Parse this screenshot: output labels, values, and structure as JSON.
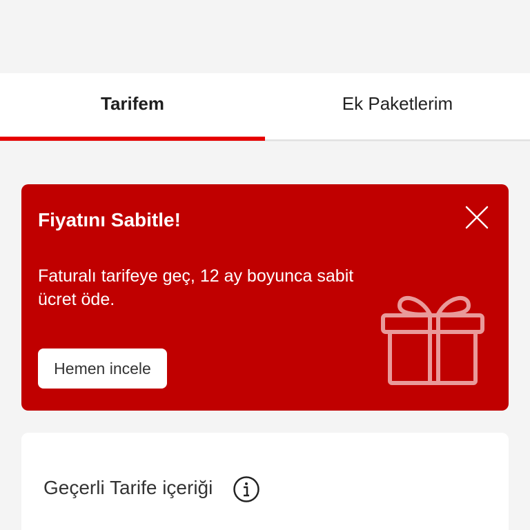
{
  "tabs": [
    {
      "label": "Tarifem",
      "active": true
    },
    {
      "label": "Ek Paketlerim",
      "active": false
    }
  ],
  "promo": {
    "title": "Fiyatını Sabitle!",
    "description": "Faturalı tarifeye geç, 12 ay boyunca sabit ücret öde.",
    "button_label": "Hemen incele",
    "close_icon": "close-icon",
    "illustration": "gift-icon"
  },
  "content": {
    "title": "Geçerli Tarife içeriği",
    "info_icon": "info-icon"
  },
  "colors": {
    "accent": "#e60000",
    "promo_background": "#c00000",
    "page_background": "#f4f4f4"
  }
}
